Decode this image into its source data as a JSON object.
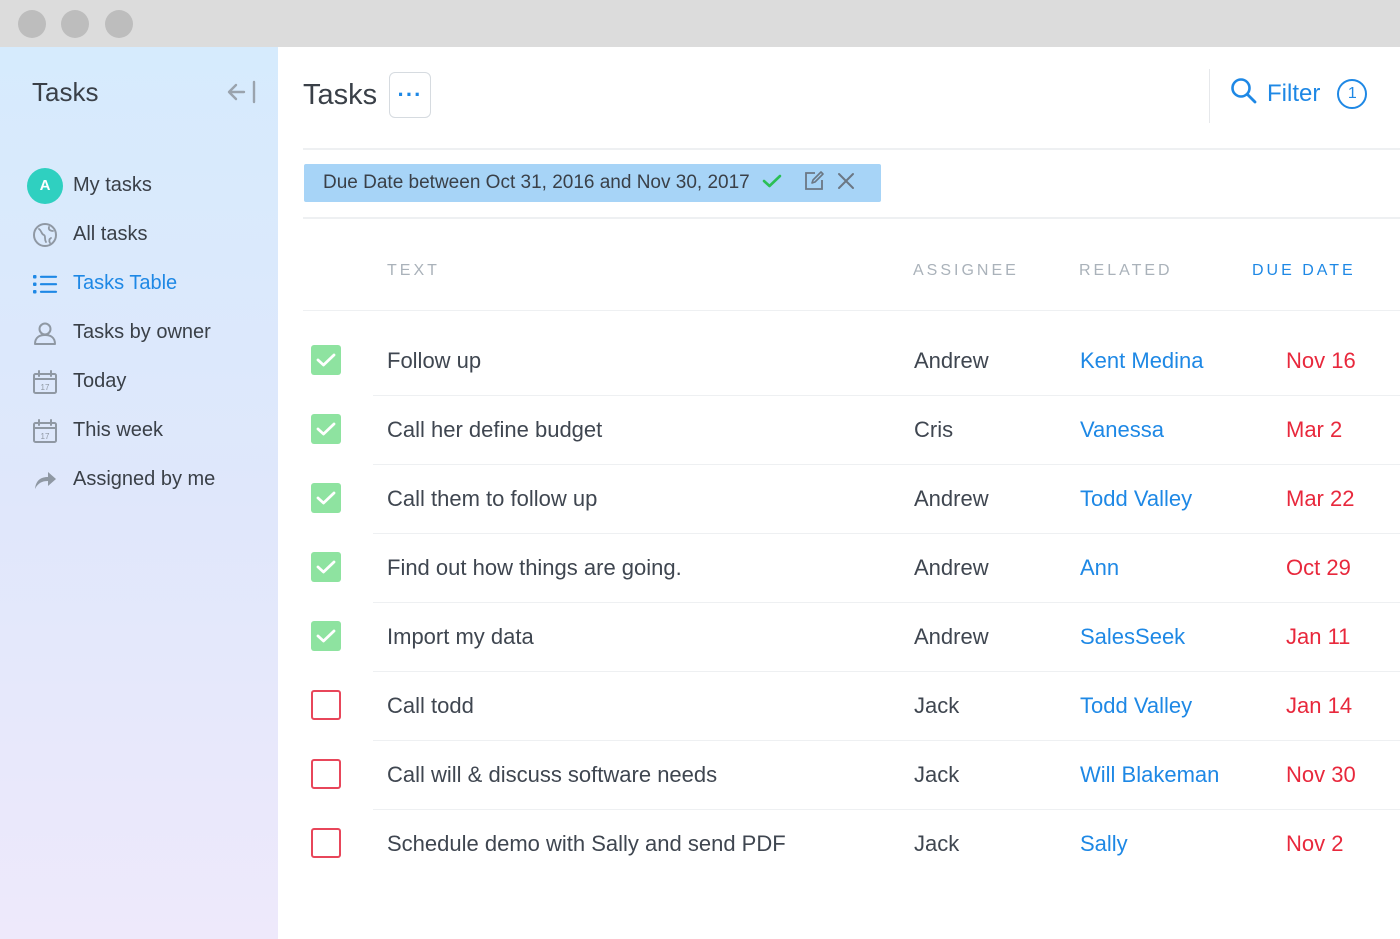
{
  "sidebar": {
    "title": "Tasks",
    "avatar_initial": "A",
    "items": [
      {
        "label": "My tasks",
        "icon": "avatar-icon"
      },
      {
        "label": "All tasks",
        "icon": "globe-icon"
      },
      {
        "label": "Tasks Table",
        "icon": "list-icon",
        "active": true
      },
      {
        "label": "Tasks by owner",
        "icon": "person-icon"
      },
      {
        "label": "Today",
        "icon": "calendar-icon",
        "day": "17"
      },
      {
        "label": "This week",
        "icon": "calendar-icon",
        "day": "17"
      },
      {
        "label": "Assigned by me",
        "icon": "share-arrow-icon"
      }
    ]
  },
  "header": {
    "title": "Tasks",
    "more_label": "···",
    "filter_label": "Filter",
    "filter_count": "1"
  },
  "filter_chip": {
    "text": "Due Date between Oct 31, 2016 and Nov 30, 2017"
  },
  "table": {
    "columns": {
      "text": "TEXT",
      "assignee": "ASSIGNEE",
      "related": "RELATED",
      "due_date": "DUE DATE"
    },
    "rows": [
      {
        "done": true,
        "text": "Follow up",
        "assignee": "Andrew",
        "related": "Kent Medina",
        "due": "Nov 16"
      },
      {
        "done": true,
        "text": "Call her define budget",
        "assignee": "Cris",
        "related": "Vanessa",
        "due": "Mar 2"
      },
      {
        "done": true,
        "text": "Call them to follow up",
        "assignee": "Andrew",
        "related": "Todd Valley",
        "due": "Mar 22"
      },
      {
        "done": true,
        "text": "Find out how things are going.",
        "assignee": "Andrew",
        "related": "Ann",
        "due": "Oct 29"
      },
      {
        "done": true,
        "text": "Import my data",
        "assignee": "Andrew",
        "related": "SalesSeek",
        "due": "Jan 11"
      },
      {
        "done": false,
        "text": "Call todd",
        "assignee": "Jack",
        "related": "Todd Valley",
        "due": "Jan 14"
      },
      {
        "done": false,
        "text": "Call will & discuss software needs",
        "assignee": "Jack",
        "related": "Will Blakeman",
        "due": "Nov 30"
      },
      {
        "done": false,
        "text": "Schedule demo with Sally and send PDF",
        "assignee": "Jack",
        "related": "Sally",
        "due": "Nov 2"
      }
    ]
  },
  "colors": {
    "accent": "#1e88e5",
    "due": "#e8283c",
    "done_checkbox": "#8ee3a0",
    "open_checkbox": "#e8465a",
    "chip": "#a7d4f7"
  }
}
